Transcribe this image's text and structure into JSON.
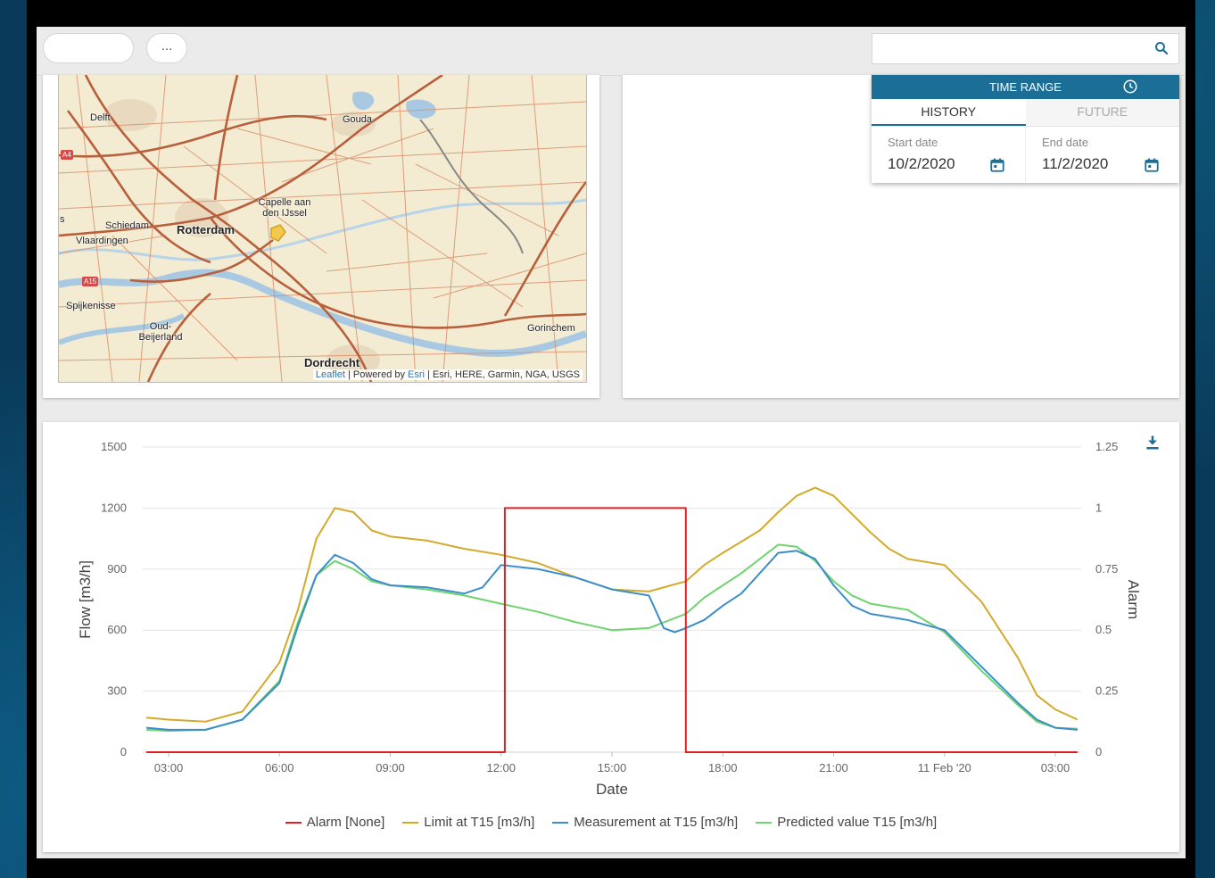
{
  "toolbar": {
    "more_label": "...",
    "search_placeholder": ""
  },
  "map": {
    "places": {
      "delft": "Delft",
      "gouda": "Gouda",
      "capelle": "Capelle aan den IJssel",
      "schiedam": "Schiedam",
      "vlaardingen": "Vlaardingen",
      "rotterdam": "Rotterdam",
      "spijkenisse": "Spijkenisse",
      "oud_beijerland": "Oud-Beijerland",
      "gorinchem": "Gorinchem",
      "dordrecht": "Dordrecht",
      "partial_s": "s"
    },
    "road_shields": {
      "a4": "A4",
      "a15": "A15"
    },
    "attribution": {
      "leaflet": "Leaflet",
      "sep": " | Powered by ",
      "esri": "Esri",
      "rest": " | Esri, HERE, Garmin, NGA, USGS"
    }
  },
  "time_range": {
    "title": "TIME RANGE",
    "tabs": [
      "HISTORY",
      "FUTURE"
    ],
    "active_tab": "HISTORY",
    "start_label": "Start date",
    "start_value": "10/2/2020",
    "end_label": "End date",
    "end_value": "11/2/2020"
  },
  "colors": {
    "accent": "#1b6f97",
    "alarm": "#e02020",
    "limit": "#d4aa2a",
    "measurement": "#3c8ec8",
    "predicted": "#6fd36f"
  },
  "chart_data": {
    "type": "line",
    "xlabel": "Date",
    "ylabel": "Flow [m3/h]",
    "y2label": "Alarm",
    "ylim": [
      0,
      1500
    ],
    "y2lim": [
      0,
      1.25
    ],
    "yticks": [
      "0",
      "300",
      "600",
      "900",
      "1200",
      "1500"
    ],
    "y2ticks": [
      "0",
      "0.25",
      "0.5",
      "0.75",
      "1",
      "1.25"
    ],
    "xlim": [
      2.3,
      27.7
    ],
    "xticks": [
      {
        "x": 3,
        "label": "03:00"
      },
      {
        "x": 6,
        "label": "06:00"
      },
      {
        "x": 9,
        "label": "09:00"
      },
      {
        "x": 12,
        "label": "12:00"
      },
      {
        "x": 15,
        "label": "15:00"
      },
      {
        "x": 18,
        "label": "18:00"
      },
      {
        "x": 21,
        "label": "21:00"
      },
      {
        "x": 24,
        "label": "11 Feb '20"
      },
      {
        "x": 27,
        "label": "03:00"
      }
    ],
    "series": [
      {
        "name": "Alarm [None]",
        "axis": "right",
        "color": "#e02020",
        "points": [
          [
            2.4,
            0
          ],
          [
            12.1,
            0
          ],
          [
            12.1,
            1
          ],
          [
            17.0,
            1
          ],
          [
            17.0,
            0
          ],
          [
            27.6,
            0
          ]
        ]
      },
      {
        "name": "Limit at T15 [m3/h]",
        "axis": "left",
        "color": "#d4aa2a",
        "points": [
          [
            2.4,
            170
          ],
          [
            3,
            160
          ],
          [
            4,
            150
          ],
          [
            5,
            200
          ],
          [
            6,
            440
          ],
          [
            6.5,
            700
          ],
          [
            7,
            1050
          ],
          [
            7.5,
            1200
          ],
          [
            8,
            1180
          ],
          [
            8.5,
            1090
          ],
          [
            9,
            1060
          ],
          [
            10,
            1040
          ],
          [
            11,
            1000
          ],
          [
            12,
            970
          ],
          [
            13,
            930
          ],
          [
            14,
            860
          ],
          [
            15,
            800
          ],
          [
            16,
            790
          ],
          [
            17,
            840
          ],
          [
            17.5,
            920
          ],
          [
            18,
            980
          ],
          [
            19,
            1090
          ],
          [
            19.5,
            1180
          ],
          [
            20,
            1260
          ],
          [
            20.5,
            1300
          ],
          [
            21,
            1260
          ],
          [
            21.5,
            1170
          ],
          [
            22,
            1080
          ],
          [
            22.5,
            1000
          ],
          [
            23,
            950
          ],
          [
            24,
            920
          ],
          [
            25,
            740
          ],
          [
            26,
            460
          ],
          [
            26.5,
            280
          ],
          [
            27,
            210
          ],
          [
            27.6,
            160
          ]
        ]
      },
      {
        "name": "Measurement at T15 [m3/h]",
        "axis": "left",
        "color": "#3c8ec8",
        "points": [
          [
            2.4,
            120
          ],
          [
            3,
            110
          ],
          [
            4,
            110
          ],
          [
            5,
            160
          ],
          [
            6,
            340
          ],
          [
            6.5,
            620
          ],
          [
            7,
            870
          ],
          [
            7.5,
            970
          ],
          [
            8,
            930
          ],
          [
            8.5,
            850
          ],
          [
            9,
            820
          ],
          [
            10,
            810
          ],
          [
            11,
            780
          ],
          [
            11.5,
            810
          ],
          [
            12,
            920
          ],
          [
            13,
            900
          ],
          [
            14,
            860
          ],
          [
            15,
            800
          ],
          [
            16,
            770
          ],
          [
            16.2,
            690
          ],
          [
            16.4,
            610
          ],
          [
            16.7,
            590
          ],
          [
            17,
            610
          ],
          [
            17.5,
            650
          ],
          [
            18,
            720
          ],
          [
            18.5,
            780
          ],
          [
            19,
            880
          ],
          [
            19.5,
            980
          ],
          [
            20,
            990
          ],
          [
            20.5,
            950
          ],
          [
            21,
            820
          ],
          [
            21.5,
            720
          ],
          [
            22,
            680
          ],
          [
            23,
            650
          ],
          [
            24,
            600
          ],
          [
            25,
            420
          ],
          [
            26,
            240
          ],
          [
            26.5,
            160
          ],
          [
            27,
            120
          ],
          [
            27.6,
            110
          ]
        ]
      },
      {
        "name": "Predicted value T15 [m3/h]",
        "axis": "left",
        "color": "#6fd36f",
        "points": [
          [
            2.4,
            110
          ],
          [
            3,
            105
          ],
          [
            4,
            110
          ],
          [
            5,
            160
          ],
          [
            6,
            350
          ],
          [
            6.5,
            640
          ],
          [
            7,
            870
          ],
          [
            7.5,
            940
          ],
          [
            8,
            900
          ],
          [
            8.5,
            840
          ],
          [
            9,
            820
          ],
          [
            10,
            800
          ],
          [
            11,
            770
          ],
          [
            12,
            730
          ],
          [
            13,
            690
          ],
          [
            14,
            640
          ],
          [
            15,
            600
          ],
          [
            16,
            610
          ],
          [
            17,
            680
          ],
          [
            17.5,
            760
          ],
          [
            18,
            820
          ],
          [
            18.5,
            880
          ],
          [
            19,
            950
          ],
          [
            19.5,
            1020
          ],
          [
            20,
            1010
          ],
          [
            20.5,
            940
          ],
          [
            21,
            840
          ],
          [
            21.5,
            770
          ],
          [
            22,
            730
          ],
          [
            23,
            700
          ],
          [
            24,
            590
          ],
          [
            25,
            400
          ],
          [
            26,
            230
          ],
          [
            26.5,
            150
          ],
          [
            27,
            120
          ],
          [
            27.6,
            115
          ]
        ]
      }
    ]
  }
}
